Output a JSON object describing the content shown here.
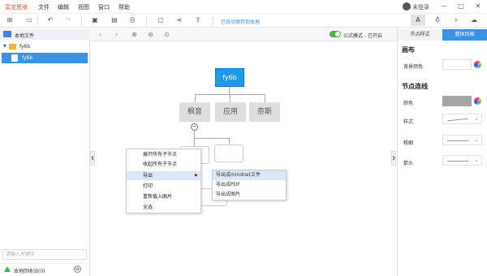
{
  "app": {
    "title": "富宝思维",
    "user": "未登录"
  },
  "menus": [
    "文件",
    "编辑",
    "视图",
    "窗口",
    "帮助"
  ],
  "window_controls": [
    "—",
    "□",
    "✕"
  ],
  "toolbar": {
    "autosave": "已自动保存到本地"
  },
  "left_panel": {
    "header": "本地文件",
    "folder": "fy6b",
    "file": "fy6b",
    "search_placeholder": "请输入关键字",
    "recycle": "本地回收站(0)"
  },
  "canvas": {
    "formula_mode": "公式模式 - 已开启"
  },
  "mindmap": {
    "root": "fy6b",
    "children": [
      "枫音",
      "应用",
      "奈斯"
    ]
  },
  "context_menu": {
    "items": [
      "展开所有子节点",
      "收起所有子节点",
      "导出",
      "打印",
      "重新载入图片",
      "全选"
    ],
    "submenu": [
      "导出成mindnet文件",
      "导出成PDF",
      "导出成图片"
    ]
  },
  "right_panel": {
    "tabs": [
      "节点样式",
      "整体风格"
    ],
    "canvas_heading": "画布",
    "bg_color_label": "背景颜色",
    "line_heading": "节点连线",
    "color_label": "颜色",
    "style_label": "样式",
    "thickness_label": "粗细",
    "arrow_label": "箭头"
  },
  "colors": {
    "accent": "#3b93e8",
    "root_node": "#1e9be8",
    "child_node": "#dedede",
    "line_color": "#a6a6a6",
    "brand": "#e45a3c"
  }
}
